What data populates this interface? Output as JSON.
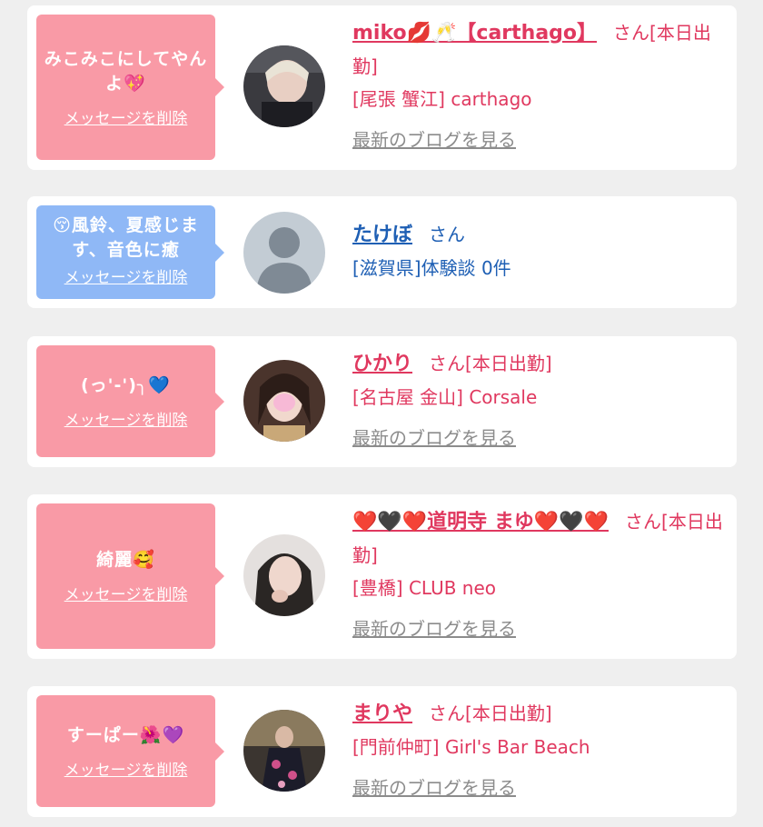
{
  "colors": {
    "page_bg": "#efefef",
    "card_bg": "#ffffff",
    "bubble_pink": "#f99aa6",
    "bubble_blue": "#8fb8f6",
    "name_pink": "#e0385f",
    "name_blue": "#1e5fb4",
    "blog_link_gray": "#8c8c8c"
  },
  "messages": [
    {
      "bubble_text": "みこみこにしてやんよ💖",
      "delete_label": "メッセージを削除",
      "name": "miko💋🥂【carthago】",
      "suffix": "さん[本日出勤]",
      "location": "[尾張 蟹江] carthago",
      "blog_link": "最新のブログを見る"
    },
    {
      "bubble_text": "😚風鈴、夏感じます、音色に癒",
      "delete_label": "メッセージを削除",
      "name": "たけぼ",
      "suffix": "さん",
      "location": "[滋賀県]体験談 0件",
      "avatar_text": "no photo"
    },
    {
      "bubble_text": "(っ'-')╮💙",
      "delete_label": "メッセージを削除",
      "name": "ひかり",
      "suffix": "さん[本日出勤]",
      "location": "[名古屋 金山] Corsale",
      "blog_link": "最新のブログを見る"
    },
    {
      "bubble_text": "綺麗🥰",
      "delete_label": "メッセージを削除",
      "name": "❤️🖤❤️道明寺 まゆ❤️🖤❤️",
      "suffix": "さん[本日出勤]",
      "location": "[豊橋] CLUB neo",
      "blog_link": "最新のブログを見る"
    },
    {
      "bubble_text": "すーぱー🌺💜",
      "delete_label": "メッセージを削除",
      "name": "まりや",
      "suffix": "さん[本日出勤]",
      "location": "[門前仲町] Girl's Bar Beach",
      "blog_link": "最新のブログを見る"
    }
  ]
}
